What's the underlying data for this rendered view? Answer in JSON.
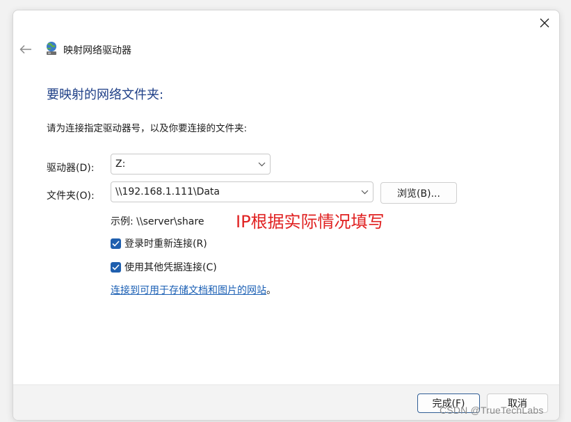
{
  "window": {
    "title": "映射网络驱动器"
  },
  "main": {
    "heading": "要映射的网络文件夹:",
    "instruction": "请为连接指定驱动器号，以及你要连接的文件夹:",
    "drive_label": "驱动器(D):",
    "drive_value": "Z:",
    "folder_label": "文件夹(O):",
    "folder_value": "\\\\192.168.1.111\\Data",
    "browse_label": "浏览(B)...",
    "example_text": "示例: \\\\server\\share",
    "annotation": "IP根据实际情况填写",
    "checkbox_reconnect": {
      "label": "登录时重新连接(R)",
      "checked": true
    },
    "checkbox_credentials": {
      "label": "使用其他凭据连接(C)",
      "checked": true
    },
    "link_text": "连接到可用于存储文档和图片的网站",
    "link_suffix": "。"
  },
  "footer": {
    "finish_label": "完成(F)",
    "cancel_label": "取消"
  },
  "watermark": "CSDN @TrueTechLabs",
  "colors": {
    "heading": "#1e3f87",
    "accent": "#1f5fae",
    "link": "#1a5fb4",
    "annotation": "#e02020"
  }
}
